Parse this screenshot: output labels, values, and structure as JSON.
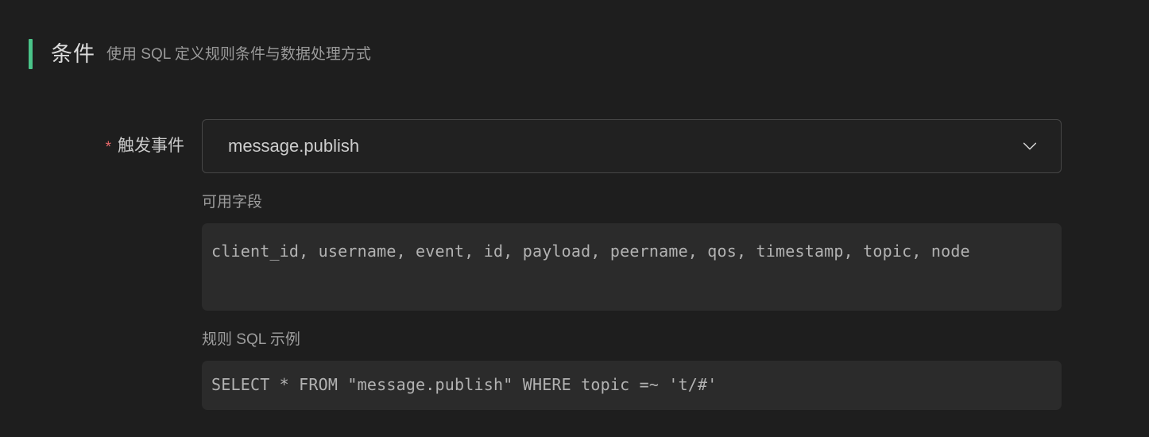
{
  "section": {
    "title": "条件",
    "subtitle": "使用 SQL 定义规则条件与数据处理方式",
    "accent_color": "#4ac489"
  },
  "form": {
    "trigger_event": {
      "label": "触发事件",
      "required_marker": "*",
      "required_color": "#e8696b",
      "selected_value": "message.publish",
      "dropdown_icon": "chevron-down-icon"
    },
    "available_fields": {
      "label": "可用字段",
      "value": "client_id, username, event, id, payload, peername, qos, timestamp, topic, node"
    },
    "sql_example": {
      "label": "规则 SQL 示例",
      "value": "SELECT * FROM \"message.publish\" WHERE topic =~ 't/#'"
    }
  },
  "theme": {
    "page_background": "#1e1e1e",
    "code_background": "#2b2b2b",
    "input_background": "#212121",
    "input_border": "#464646"
  }
}
